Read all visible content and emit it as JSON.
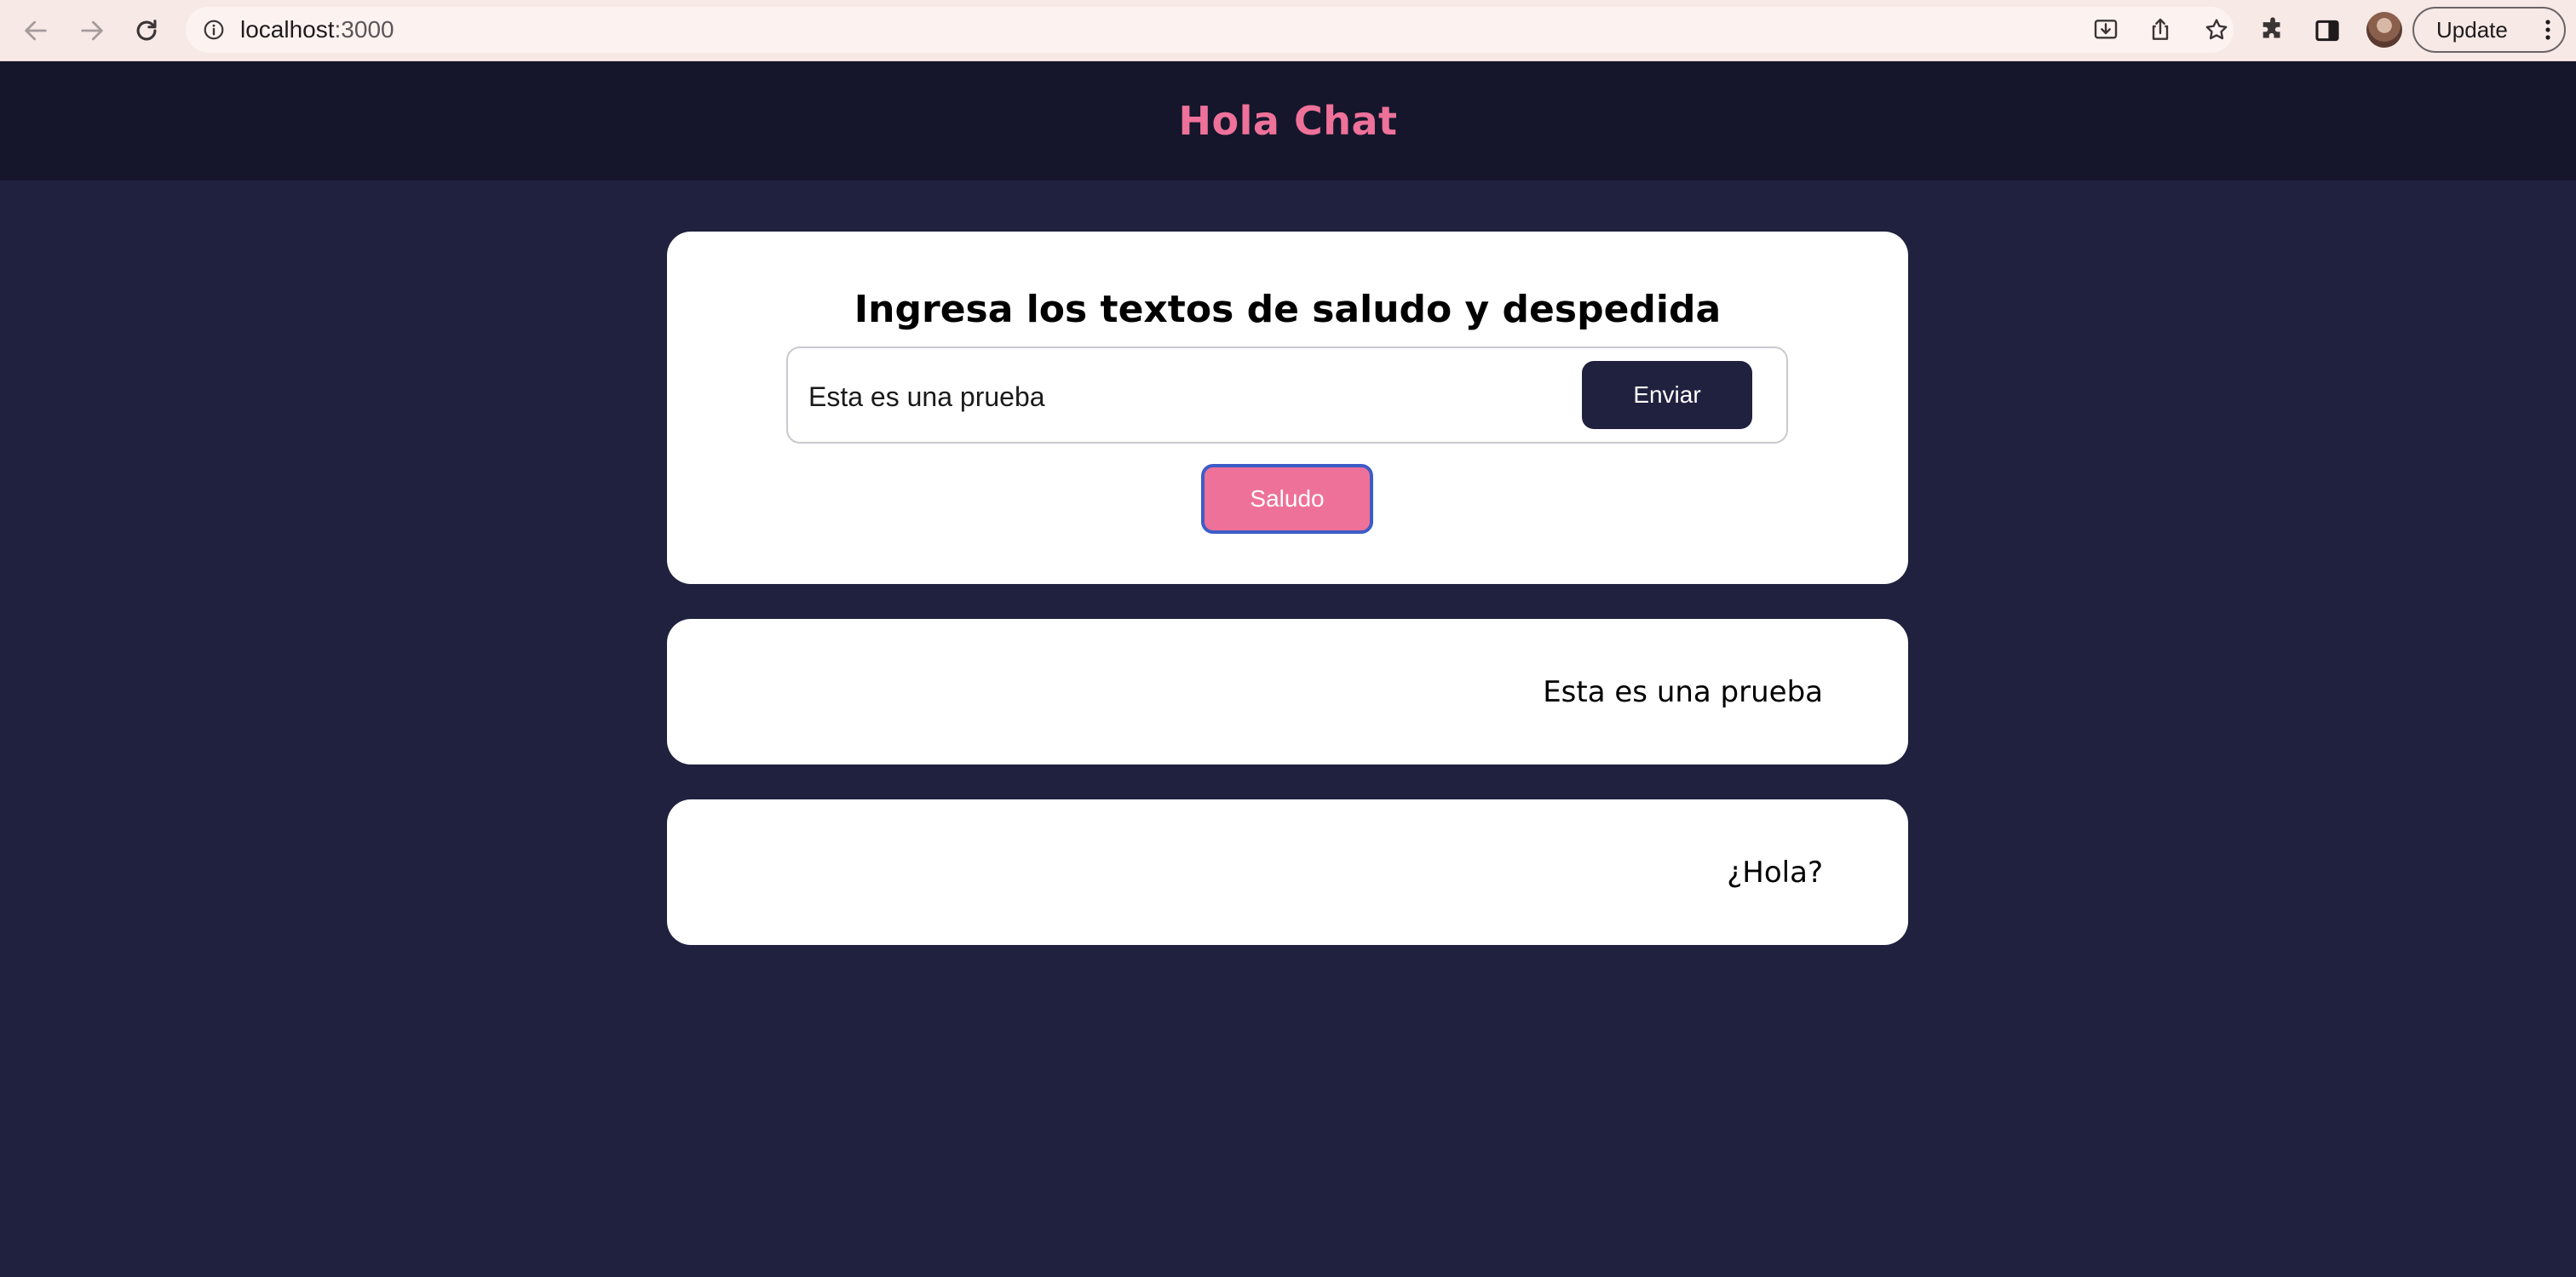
{
  "browser": {
    "url_host": "localhost",
    "url_port": ":3000",
    "update_label": "Update",
    "icons": [
      "back-arrow-icon",
      "forward-arrow-icon",
      "reload-icon",
      "site-info-icon",
      "install-app-icon",
      "share-icon",
      "bookmark-star-icon",
      "extensions-puzzle-icon",
      "side-panel-icon",
      "profile-avatar",
      "more-menu-icon"
    ]
  },
  "header": {
    "title": "Hola Chat"
  },
  "form": {
    "heading": "Ingresa los textos de saludo y despedida",
    "input_value": "Esta es una prueba",
    "send_label": "Enviar",
    "greet_label": "Saludo"
  },
  "messages": [
    {
      "text": "Esta es una prueba"
    },
    {
      "text": "¿Hola?"
    }
  ],
  "colors": {
    "background": "#20213f",
    "header_bg": "#15162b",
    "accent_pink": "#ee7199",
    "button_dark": "#20213f",
    "card": "#ffffff",
    "chrome_bg": "#f7e9e6"
  }
}
